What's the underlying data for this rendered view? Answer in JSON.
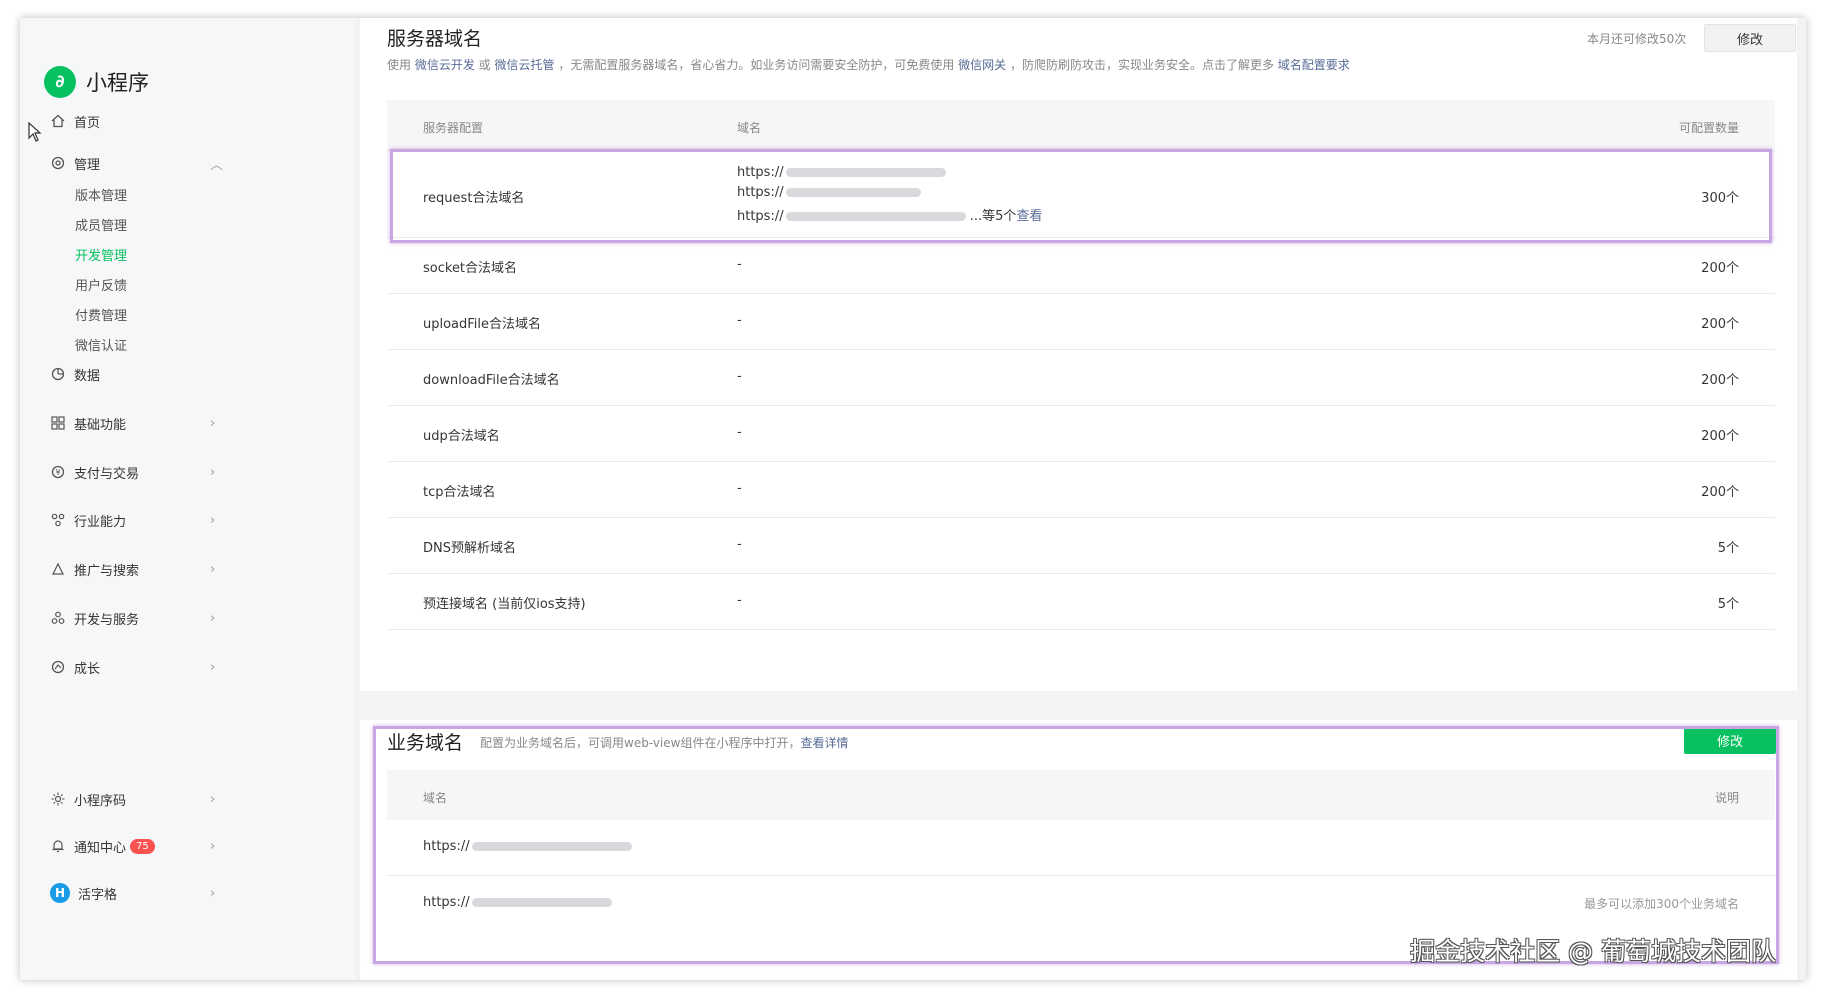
{
  "app": {
    "name": "小程序",
    "logo_glyph": "∂"
  },
  "sidebar": {
    "home": "首页",
    "manage": "管理",
    "sub_items": [
      "版本管理",
      "成员管理",
      "开发管理",
      "用户反馈",
      "付费管理",
      "微信认证"
    ],
    "active_sub": "开发管理",
    "data": "数据",
    "items": [
      "基础功能",
      "支付与交易",
      "行业能力",
      "推广与搜索",
      "开发与服务",
      "成长"
    ],
    "bottom": {
      "qrcode": "小程序码",
      "notify": "通知中心",
      "notify_count": "75",
      "user": "活字格",
      "user_avatar": "H"
    }
  },
  "server_domain": {
    "title": "服务器域名",
    "desc_parts": [
      "使用 ",
      "微信云开发",
      " 或 ",
      "微信云托管",
      " ，无需配置服务器域名，省心省力。如业务访问需要安全防护，可免费使用 ",
      "微信网关",
      " ，防爬防刷防攻击，实现业务安全。点击了解更多 ",
      "域名配置要求"
    ],
    "remaining": "本月还可修改50次",
    "edit_label": "修改",
    "columns": [
      "服务器配置",
      "域名",
      "可配置数量"
    ],
    "request": {
      "name": "request合法域名",
      "prefix": "https://",
      "more": "...等5个",
      "view": "查看",
      "count": "300个"
    },
    "rows": [
      {
        "name": "socket合法域名",
        "domain": "-",
        "count": "200个"
      },
      {
        "name": "uploadFile合法域名",
        "domain": "-",
        "count": "200个"
      },
      {
        "name": "downloadFile合法域名",
        "domain": "-",
        "count": "200个"
      },
      {
        "name": "udp合法域名",
        "domain": "-",
        "count": "200个"
      },
      {
        "name": "tcp合法域名",
        "domain": "-",
        "count": "200个"
      },
      {
        "name": "DNS预解析域名",
        "domain": "-",
        "count": "5个"
      },
      {
        "name": "预连接域名 (当前仅ios支持)",
        "domain": "-",
        "count": "5个"
      }
    ]
  },
  "biz_domain": {
    "title": "业务域名",
    "desc": "配置为业务域名后，可调用web-view组件在小程序中打开，",
    "desc_link": "查看详情",
    "edit_label": "修改",
    "columns": [
      "域名",
      "说明"
    ],
    "rows": [
      {
        "domain": "https://"
      },
      {
        "domain": "https://"
      }
    ],
    "limit_note": "最多可以添加300个业务域名"
  },
  "watermark": "掘金技术社区 @ 葡萄城技术团队",
  "colors": {
    "brand_green": "#07c160",
    "link": "#576b95",
    "badge_red": "#fa5151",
    "highlight": "#c8a6e3"
  }
}
